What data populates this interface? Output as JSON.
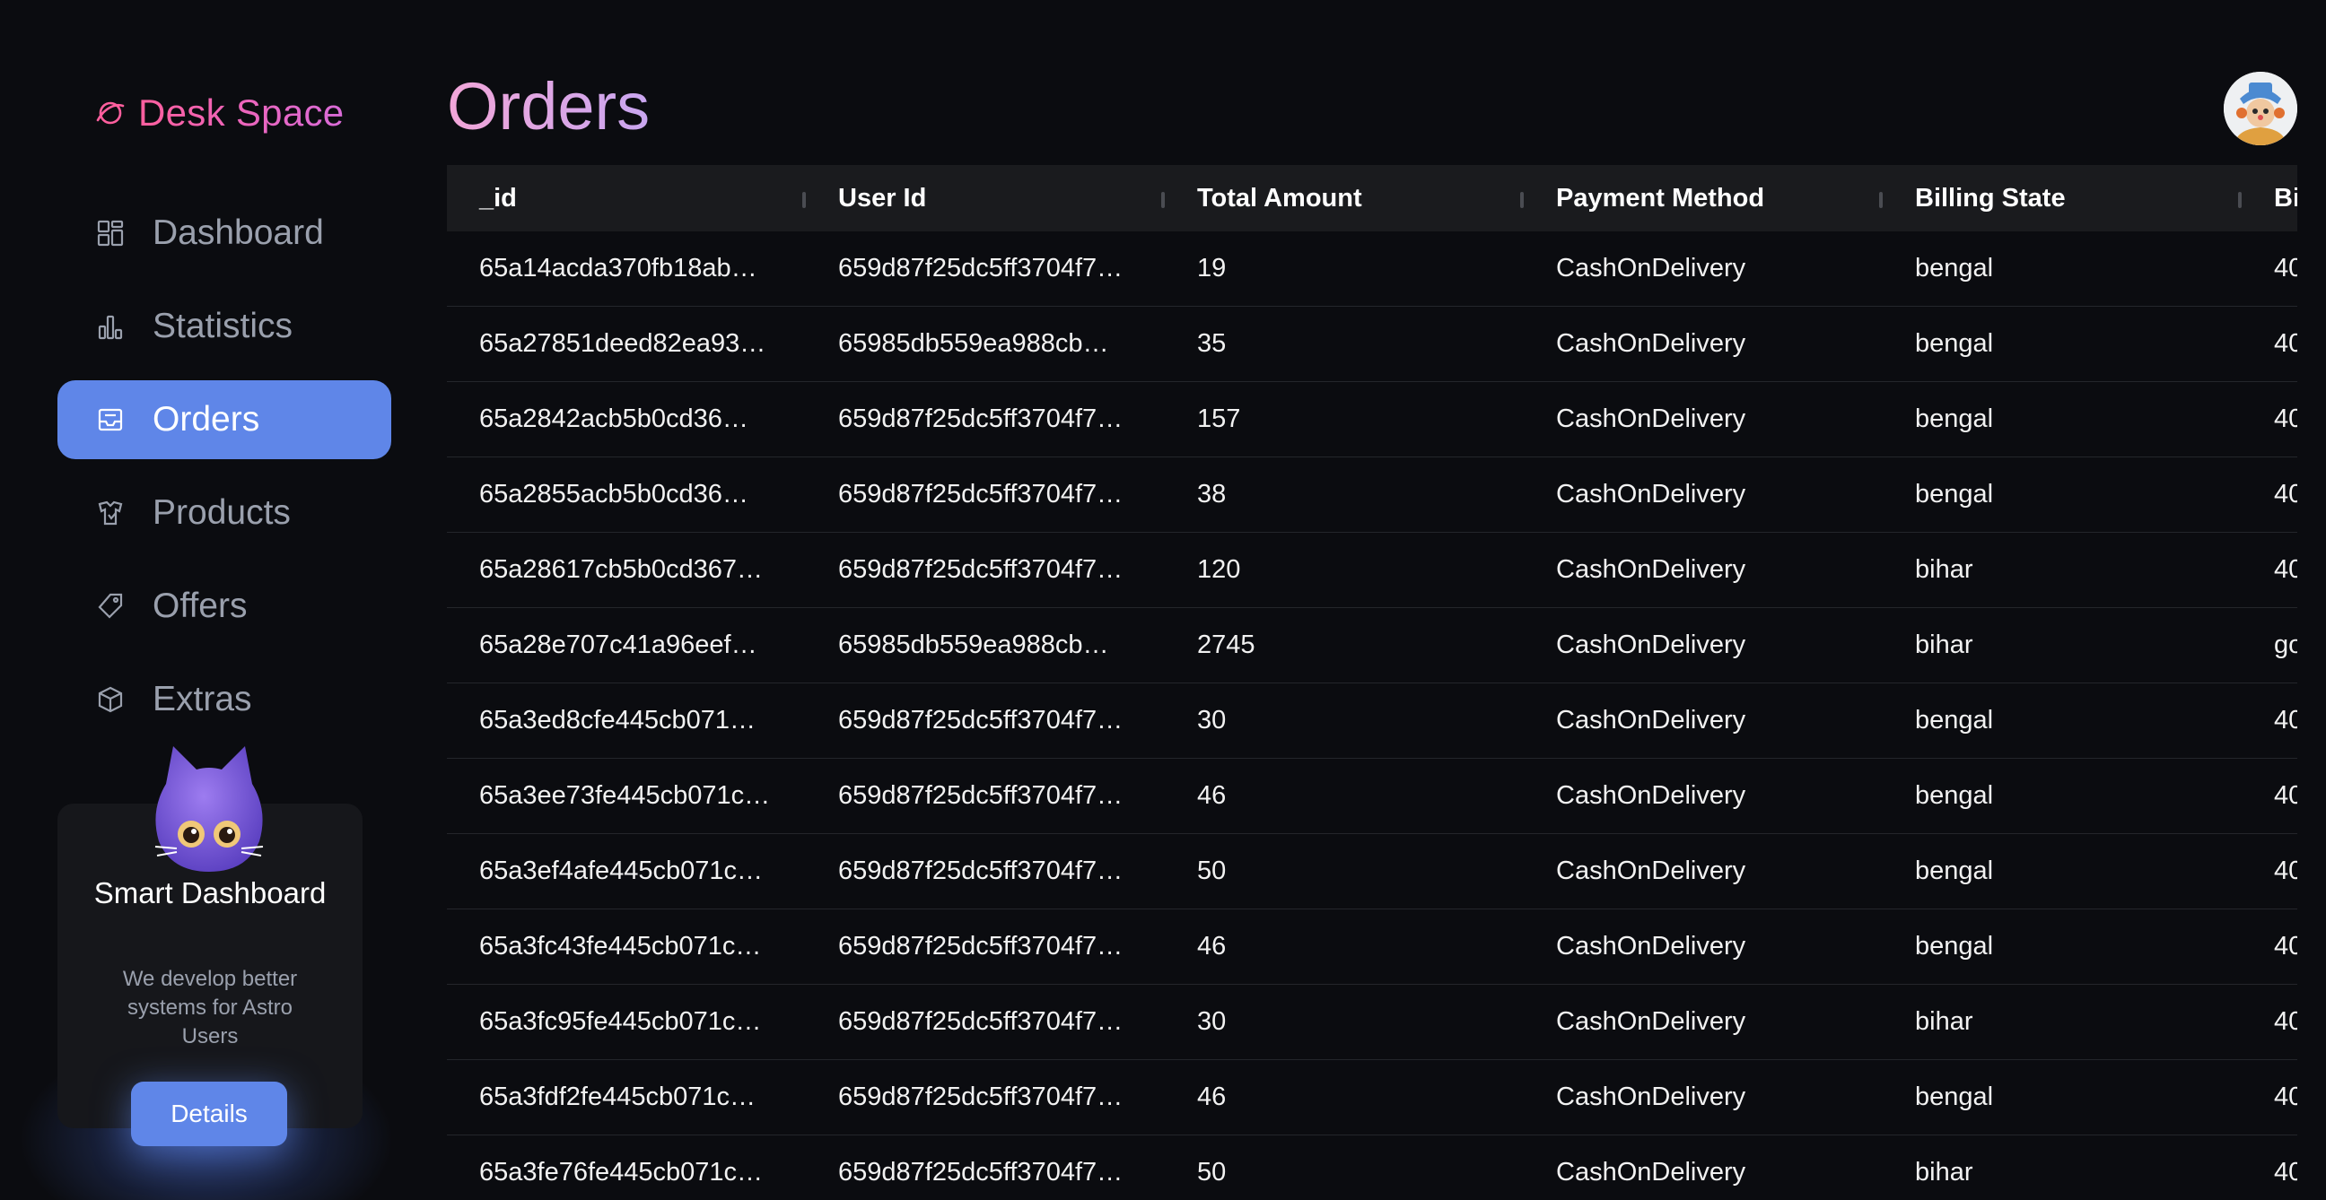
{
  "brand": {
    "name": "Desk Space",
    "icon": "planet-icon",
    "accent": "#ff5f9e"
  },
  "nav": {
    "items": [
      {
        "label": "Dashboard",
        "icon": "dashboard-icon"
      },
      {
        "label": "Statistics",
        "icon": "bar-chart-icon"
      },
      {
        "label": "Orders",
        "icon": "inbox-icon",
        "active": true
      },
      {
        "label": "Products",
        "icon": "product-icon"
      },
      {
        "label": "Offers",
        "icon": "tag-icon"
      },
      {
        "label": "Extras",
        "icon": "cube-icon"
      }
    ],
    "active_color": "#5f86e8"
  },
  "promo": {
    "title": "Smart Dashboard",
    "text": "We develop better systems for Astro Users",
    "button": "Details"
  },
  "page": {
    "title": "Orders"
  },
  "table": {
    "columns": [
      "_id",
      "User Id",
      "Total Amount",
      "Payment Method",
      "Billing State",
      "Bi"
    ],
    "rows": [
      [
        "65a14acda370fb18ab…",
        "659d87f25dc5ff3704f7…",
        "19",
        "CashOnDelivery",
        "bengal",
        "40"
      ],
      [
        "65a27851deed82ea93…",
        "65985db559ea988cb…",
        "35",
        "CashOnDelivery",
        "bengal",
        "40"
      ],
      [
        "65a2842acb5b0cd36…",
        "659d87f25dc5ff3704f7…",
        "157",
        "CashOnDelivery",
        "bengal",
        "40"
      ],
      [
        "65a2855acb5b0cd36…",
        "659d87f25dc5ff3704f7…",
        "38",
        "CashOnDelivery",
        "bengal",
        "40"
      ],
      [
        "65a28617cb5b0cd367…",
        "659d87f25dc5ff3704f7…",
        "120",
        "CashOnDelivery",
        "bihar",
        "40"
      ],
      [
        "65a28e707c41a96eef…",
        "65985db559ea988cb…",
        "2745",
        "CashOnDelivery",
        "bihar",
        "go"
      ],
      [
        "65a3ed8cfe445cb071…",
        "659d87f25dc5ff3704f7…",
        "30",
        "CashOnDelivery",
        "bengal",
        "40"
      ],
      [
        "65a3ee73fe445cb071c…",
        "659d87f25dc5ff3704f7…",
        "46",
        "CashOnDelivery",
        "bengal",
        "40"
      ],
      [
        "65a3ef4afe445cb071c…",
        "659d87f25dc5ff3704f7…",
        "50",
        "CashOnDelivery",
        "bengal",
        "40"
      ],
      [
        "65a3fc43fe445cb071c…",
        "659d87f25dc5ff3704f7…",
        "46",
        "CashOnDelivery",
        "bengal",
        "40"
      ],
      [
        "65a3fc95fe445cb071c…",
        "659d87f25dc5ff3704f7…",
        "30",
        "CashOnDelivery",
        "bihar",
        "40"
      ],
      [
        "65a3fdf2fe445cb071c…",
        "659d87f25dc5ff3704f7…",
        "46",
        "CashOnDelivery",
        "bengal",
        "40"
      ],
      [
        "65a3fe76fe445cb071c…",
        "659d87f25dc5ff3704f7…",
        "50",
        "CashOnDelivery",
        "bihar",
        "40"
      ]
    ]
  }
}
